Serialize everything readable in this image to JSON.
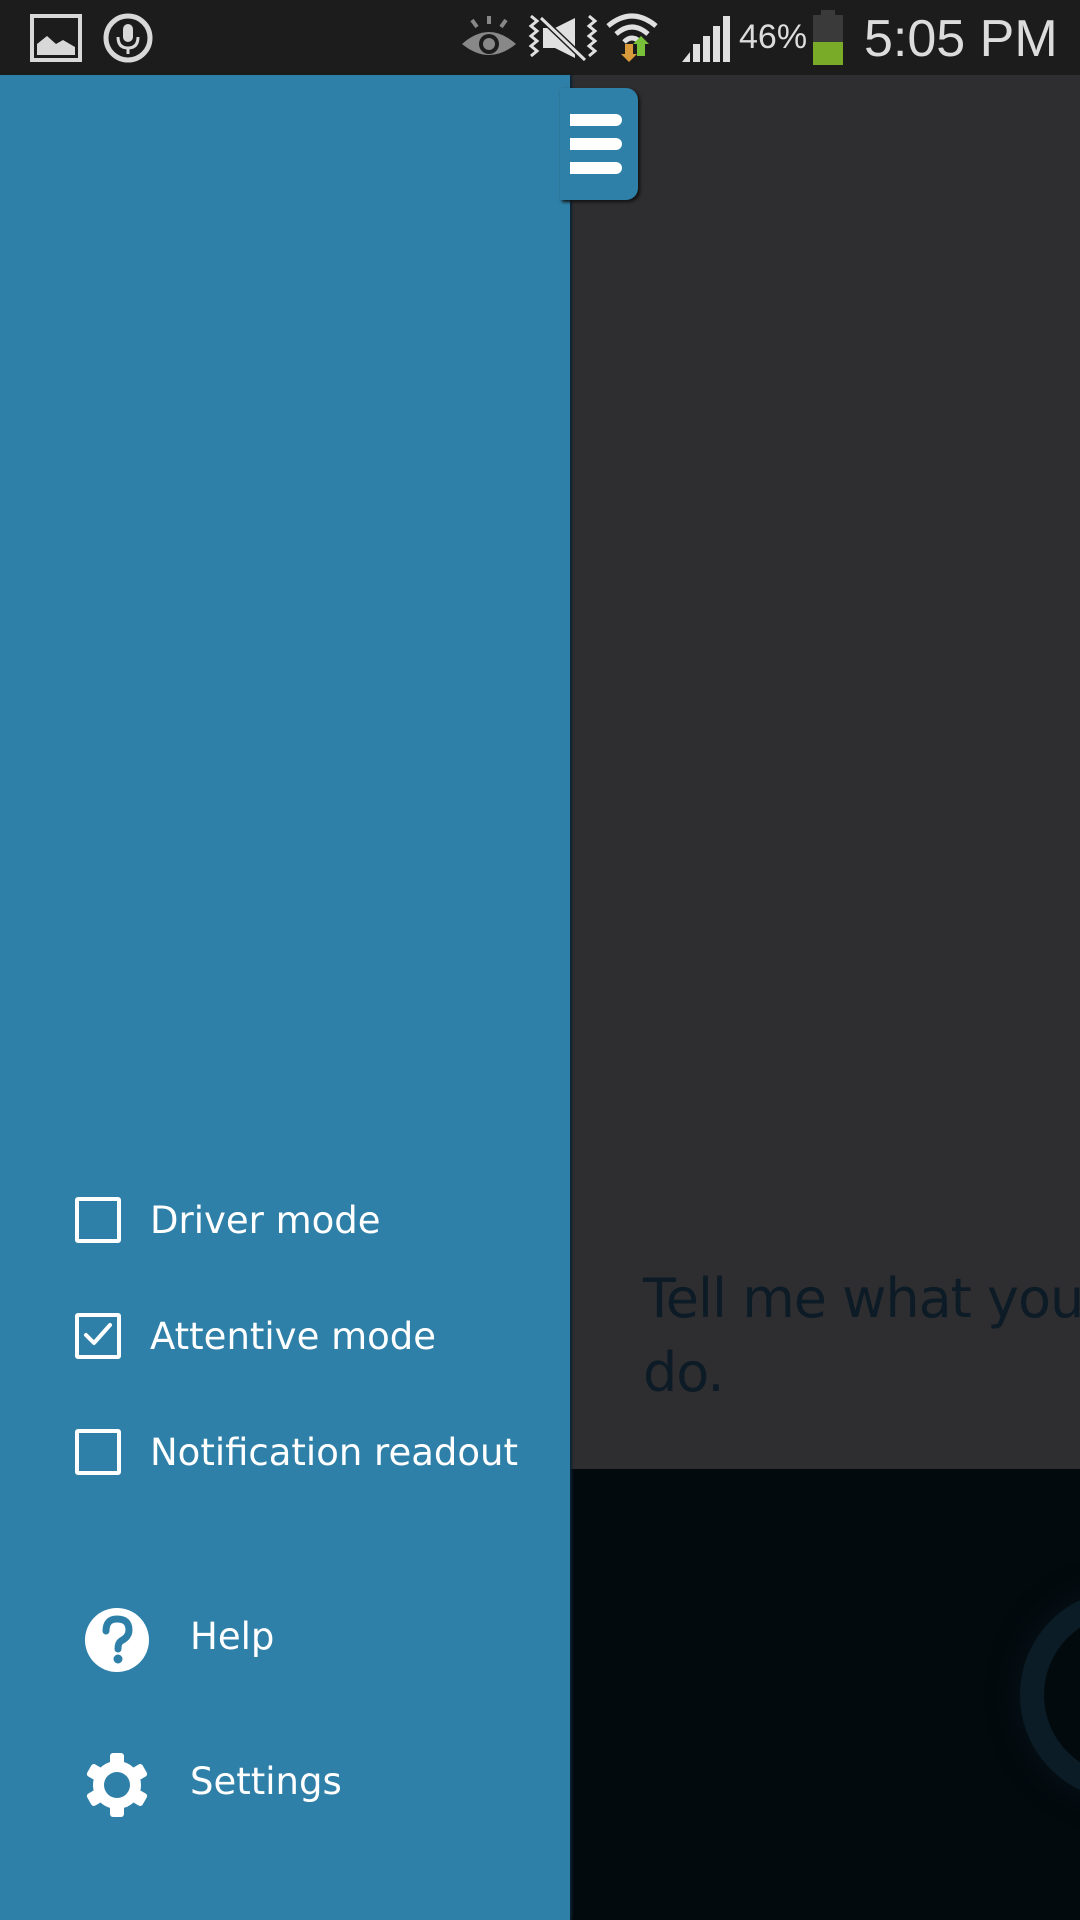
{
  "status_bar": {
    "left_icons": [
      "gallery-icon",
      "voice-mic-icon"
    ],
    "right_icons": [
      "smart-stay-eye-icon",
      "mute-icon",
      "wifi-icon",
      "signal-icon",
      "battery-icon"
    ],
    "battery_percent": "46%",
    "battery_level": 0.46,
    "time": "5:05 PM"
  },
  "drawer": {
    "toggles": [
      {
        "label": "Driver mode",
        "checked": false
      },
      {
        "label": "Attentive mode",
        "checked": true
      },
      {
        "label": "Notification readout",
        "checked": false
      }
    ],
    "menu": [
      {
        "label": "Help",
        "icon": "help-icon"
      },
      {
        "label": "Settings",
        "icon": "settings-gear-icon"
      }
    ]
  },
  "main": {
    "prompt_line1": "Tell me what you",
    "prompt_line2": "do."
  },
  "colors": {
    "drawer": "#2f80a8",
    "main_panel": "#2e2e30",
    "background": "#030a0e",
    "battery_fill": "#7aab28"
  }
}
